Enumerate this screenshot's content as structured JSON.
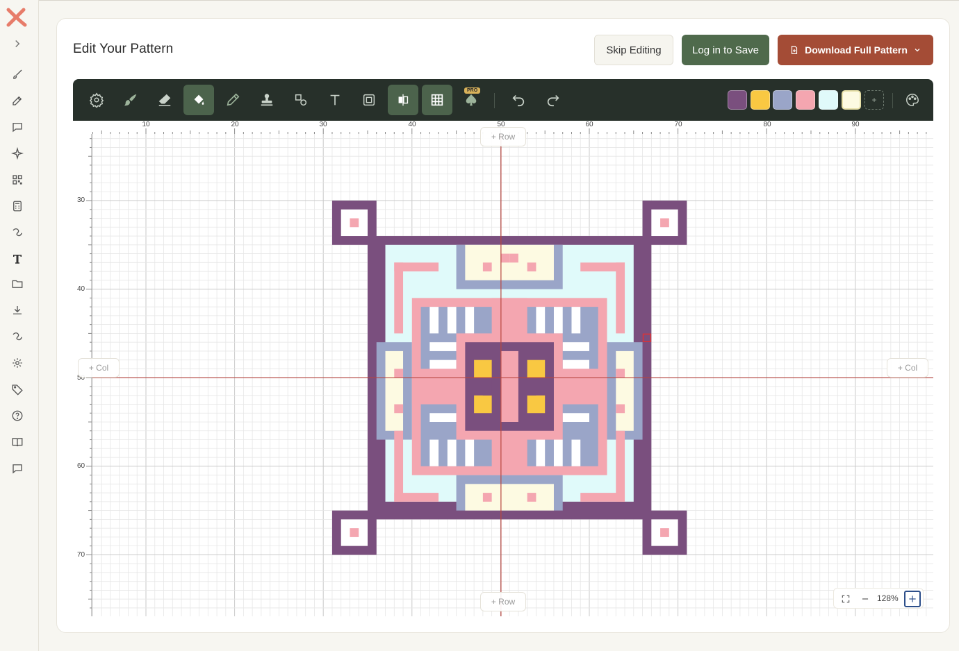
{
  "page": {
    "title": "Edit Your Pattern"
  },
  "header_buttons": {
    "skip": "Skip Editing",
    "login": "Log in to Save",
    "download": "Download Full Pattern"
  },
  "sidebar": {
    "items": [
      "chevron-right-icon",
      "brush-icon",
      "edit-icon",
      "comment-icon",
      "sparkle-icon",
      "qr-icon",
      "calculator-icon",
      "yarn-icon",
      "text-icon",
      "folder-icon",
      "download-icon",
      "yarn2-icon",
      "settings-icon",
      "tag-icon",
      "help-icon",
      "book-icon",
      "chat-icon"
    ]
  },
  "toolbar": {
    "tools": [
      "settings-icon",
      "brush-icon",
      "eraser-icon",
      "fill-bucket-icon",
      "eyedropper-icon",
      "stamp-icon",
      "shapes-icon",
      "text-icon",
      "frame-icon",
      "mirror-icon",
      "grid-icon",
      "spade-icon",
      "undo-icon",
      "redo-icon"
    ],
    "pro_label": "PRO",
    "palette": [
      "#7a4f7e",
      "#f9c842",
      "#9aa5c8",
      "#f4a6b0",
      "#e0fafa",
      "#fdfae2"
    ],
    "add_color": "+"
  },
  "canvas": {
    "ruler_top": [
      "10",
      "20",
      "30",
      "40",
      "50",
      "60",
      "70",
      "80",
      "90"
    ],
    "ruler_left": [
      "30",
      "40",
      "50",
      "60",
      "70"
    ],
    "add_row_top": "+ Row",
    "add_row_bottom": "+ Row",
    "add_col_left": "+ Col",
    "add_col_right": "+ Col"
  },
  "zoom": {
    "level": "128%"
  },
  "colors": {
    "toolbar_bg": "#27302a",
    "accent_green": "#4f6a4c",
    "accent_rust": "#a44c36",
    "center_line": "#b8453f"
  }
}
